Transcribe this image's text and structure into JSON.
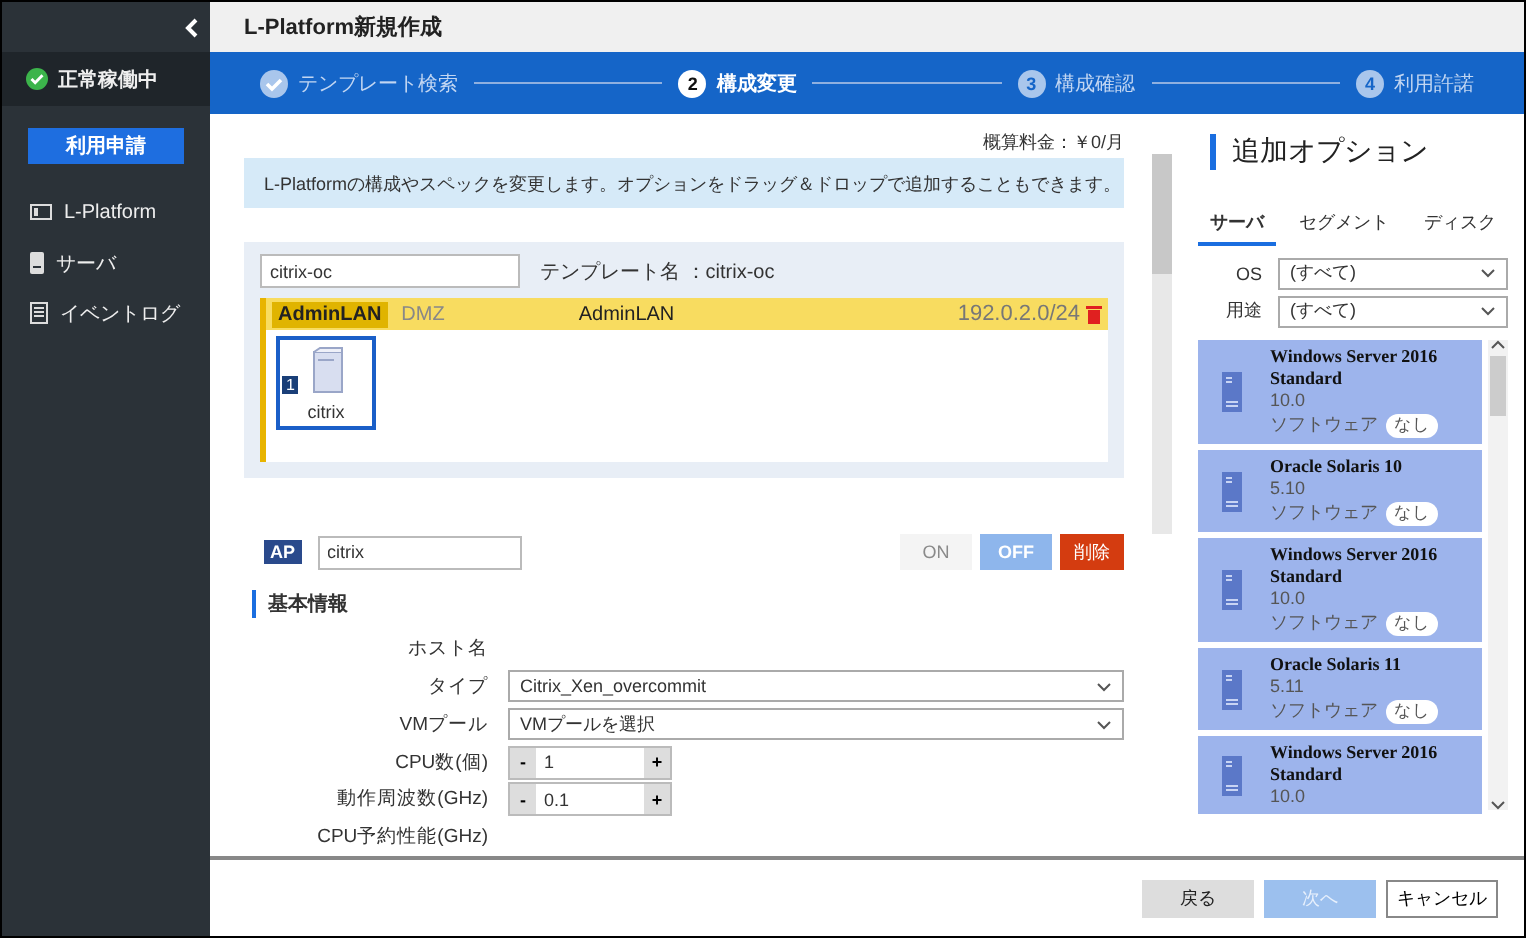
{
  "window": {
    "title": "L-Platform新規作成"
  },
  "sidebar": {
    "status": "正常稼働中",
    "request_button": "利用申請",
    "items": [
      {
        "label": "L-Platform",
        "kind": "platform"
      },
      {
        "label": "サーバ",
        "kind": "server"
      },
      {
        "label": "イベントログ",
        "kind": "log"
      }
    ]
  },
  "steps": [
    {
      "label": "テンプレート検索",
      "done": true,
      "selected": false
    },
    {
      "number": "2",
      "label": "構成変更",
      "done": false,
      "selected": true
    },
    {
      "number": "3",
      "label": "構成確認",
      "done": false,
      "selected": false
    },
    {
      "number": "4",
      "label": "利用許諾",
      "done": false,
      "selected": false
    }
  ],
  "main": {
    "price": "概算料金：￥0/月",
    "info": "L-Platformの構成やスペックを変更します。オプションをドラッグ＆ドロップで追加することもできます。",
    "platform_name": "citrix-oc",
    "template_label": "テンプレート名 ：citrix-oc",
    "segment": {
      "tags": [
        {
          "label": "AdminLAN",
          "selected": true
        },
        {
          "label": "DMZ",
          "selected": false
        }
      ],
      "name": "AdminLAN",
      "address": "192.0.2.0/24"
    },
    "servers": [
      {
        "count": "1",
        "name": "citrix",
        "selected": true
      }
    ],
    "detail": {
      "type_badge": "AP",
      "name": "citrix",
      "power": [
        {
          "label": "ON",
          "selected": false
        },
        {
          "label": "OFF",
          "selected": true
        }
      ],
      "delete_button": "削除",
      "section_title": "基本情報",
      "fields": [
        {
          "label": "ホスト名",
          "kind": "label"
        },
        {
          "label": "タイプ",
          "kind": "select",
          "value": "Citrix_Xen_overcommit"
        },
        {
          "label": "VMプール",
          "kind": "select",
          "value": "VMプールを選択"
        },
        {
          "label": "CPU数(個)",
          "kind": "stepper",
          "value": "1",
          "decrement": "-",
          "increment": "+"
        },
        {
          "label": "動作周波数(GHz)",
          "kind": "stepper",
          "value": "0.1",
          "decrement": "-",
          "increment": "+"
        },
        {
          "label": "CPU予約性能(GHz)",
          "kind": "label"
        }
      ]
    }
  },
  "options": {
    "title": "追加オプション",
    "tabs": [
      {
        "label": "サーバ",
        "selected": true
      },
      {
        "label": "セグメント",
        "selected": false
      },
      {
        "label": "ディスク",
        "selected": false
      }
    ],
    "filters": [
      {
        "label": "OS",
        "value": "(すべて)"
      },
      {
        "label": "用途",
        "value": "(すべて)"
      }
    ],
    "cards": [
      {
        "name": "Windows Server 2016 Standard",
        "version": "10.0",
        "software_label": "ソフトウェア",
        "software_value": "なし"
      },
      {
        "name": "Oracle Solaris 10",
        "version": "5.10",
        "software_label": "ソフトウェア",
        "software_value": "なし"
      },
      {
        "name": "Windows Server 2016 Standard",
        "version": "10.0",
        "software_label": "ソフトウェア",
        "software_value": "なし"
      },
      {
        "name": "Oracle Solaris 11",
        "version": "5.11",
        "software_label": "ソフトウェア",
        "software_value": "なし"
      },
      {
        "name": "Windows Server 2016 Standard",
        "version": "10.0"
      }
    ]
  },
  "buttons": [
    {
      "label": "戻る",
      "kind": "back",
      "disabled": false
    },
    {
      "label": "次へ",
      "kind": "next",
      "disabled": true
    },
    {
      "label": "キャンセル",
      "kind": "cancel",
      "disabled": false
    }
  ]
}
